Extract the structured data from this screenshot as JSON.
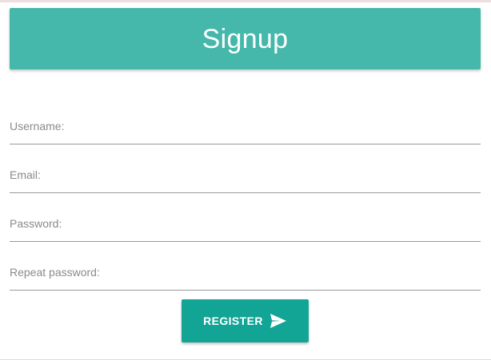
{
  "header": {
    "title": "Signup"
  },
  "form": {
    "fields": [
      {
        "label": "Username:",
        "value": ""
      },
      {
        "label": "Email:",
        "value": ""
      },
      {
        "label": "Password:",
        "value": ""
      },
      {
        "label": "Repeat password:",
        "value": ""
      }
    ],
    "submit": {
      "label": "REGISTER",
      "icon": "send-icon"
    }
  },
  "colors": {
    "header_bg": "#45b8ab",
    "button_bg": "#12a495",
    "label_text": "#8a8a8a",
    "underline": "#9a9a9a"
  }
}
